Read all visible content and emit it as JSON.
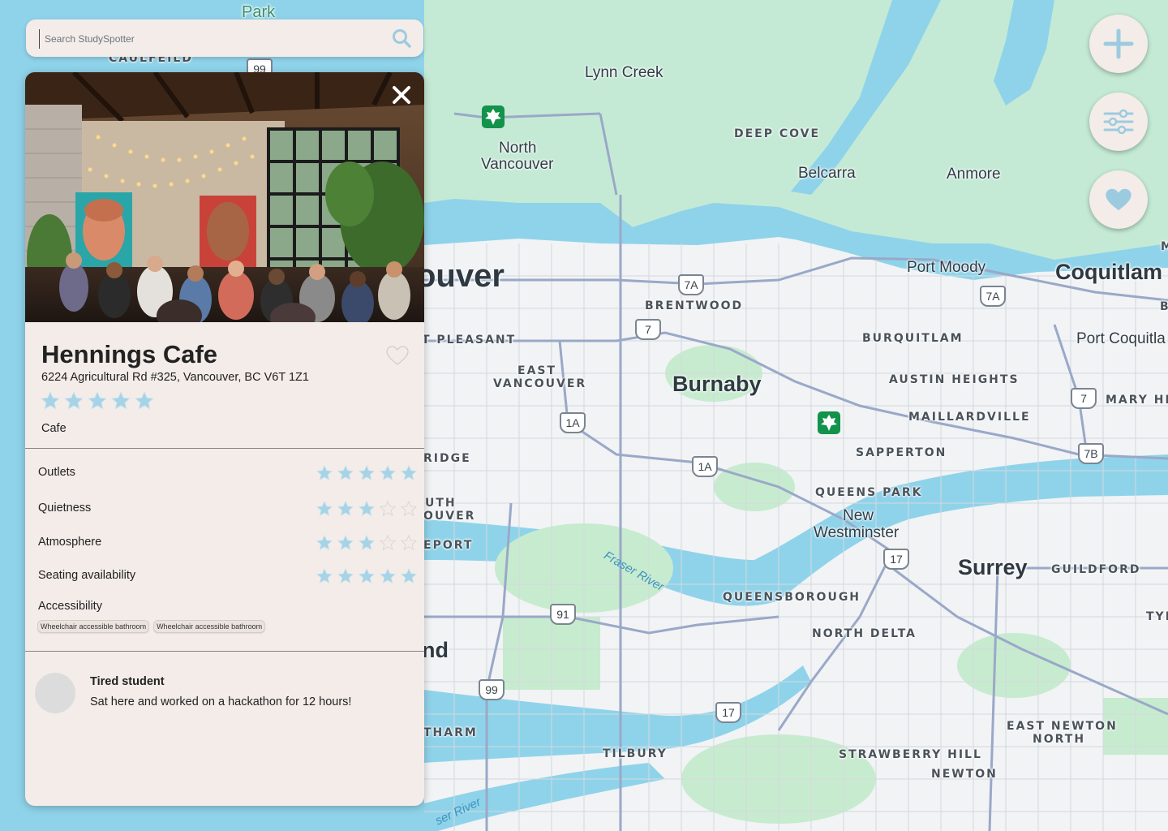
{
  "search": {
    "placeholder": "Search StudySpotter",
    "value": ""
  },
  "place": {
    "name": "Hennings Cafe",
    "address": "6224 Agricultural Rd #325, Vancouver, BC V6T 1Z1",
    "overall_rating": 5,
    "category": "Cafe"
  },
  "ratings": [
    {
      "label": "Outlets",
      "value": 5
    },
    {
      "label": "Quietness",
      "value": 3
    },
    {
      "label": "Atmosphere",
      "value": 3
    },
    {
      "label": "Seating availability",
      "value": 5
    }
  ],
  "accessibility": {
    "label": "Accessibility",
    "tags": [
      "Wheelchair accessible bathroom",
      "Wheelchair accessible bathroom"
    ]
  },
  "review": {
    "author": "Tired student",
    "text": "Sat here and worked on a hackathon for 12 hours!"
  },
  "map": {
    "labels": {
      "park": "Park",
      "caulfeild": "CAULFEILD",
      "lynn_creek": "Lynn Creek",
      "north_vancouver_1": "North",
      "north_vancouver_2": "Vancouver",
      "deep_cove": "DEEP COVE",
      "belcarra": "Belcarra",
      "anmore": "Anmore",
      "vancouver": "ouver",
      "port_moody": "Port Moody",
      "coquitlam": "Coquitlam",
      "brentwood": "BRENTWOOD",
      "mt_pleasant": "T PLEASANT",
      "burquitlam": "BURQUITLAM",
      "port_coquitlam": "Port Coquitla",
      "east_van_1": "EAST",
      "east_van_2": "VANCOUVER",
      "burnaby": "Burnaby",
      "austin_heights": "AUSTIN HEIGHTS",
      "mary_hill": "MARY HIL",
      "maillardville": "MAILLARDVILLE",
      "ridge": "RIDGE",
      "sapperton": "SAPPERTON",
      "queens_park": "QUEENS PARK",
      "south_van_1": "UTH",
      "south_van_2": "OUVER",
      "new_west_1": "New",
      "new_west_2": "Westminster",
      "marpole": "EPORT",
      "fraser_river": "Fraser River",
      "surrey": "Surrey",
      "guildford": "GUILDFORD",
      "queensborough": "QUEENSBOROUGH",
      "tyn": "TYI",
      "north_delta": "NORTH DELTA",
      "richmond": "nd",
      "tharm": "THARM",
      "east_newton_1": "EAST NEWTON",
      "east_newton_2": "NORTH",
      "tilbury": "TILBURY",
      "strawberry_hill": "STRAWBERRY HILL",
      "newton": "NEWTON",
      "fraser_river_2": "ser River",
      "m": "M",
      "b": "B"
    },
    "shields": {
      "hwy99_top": "99",
      "hwy7a_1": "7A",
      "hwy7a_2": "7A",
      "hwy7": "7",
      "hwy7_b": "7",
      "hwy1a_1": "1A",
      "hwy1a_2": "1A",
      "hwy7b": "7B",
      "hwy17": "17",
      "hwy91": "91",
      "hwy99": "99",
      "hwy17_b": "17"
    }
  },
  "colors": {
    "panel_bg": "#f3ece8",
    "star_fill": "#a7d3e6",
    "star_empty": "#f1ece8",
    "water": "#8fd3ea",
    "park": "#bfe8cf"
  },
  "icons": {
    "search": "search-icon",
    "close": "close-icon",
    "favorite": "heart-icon",
    "zoom_in": "plus-icon",
    "filter": "sliders-icon",
    "favorites_list": "heart-icon"
  }
}
